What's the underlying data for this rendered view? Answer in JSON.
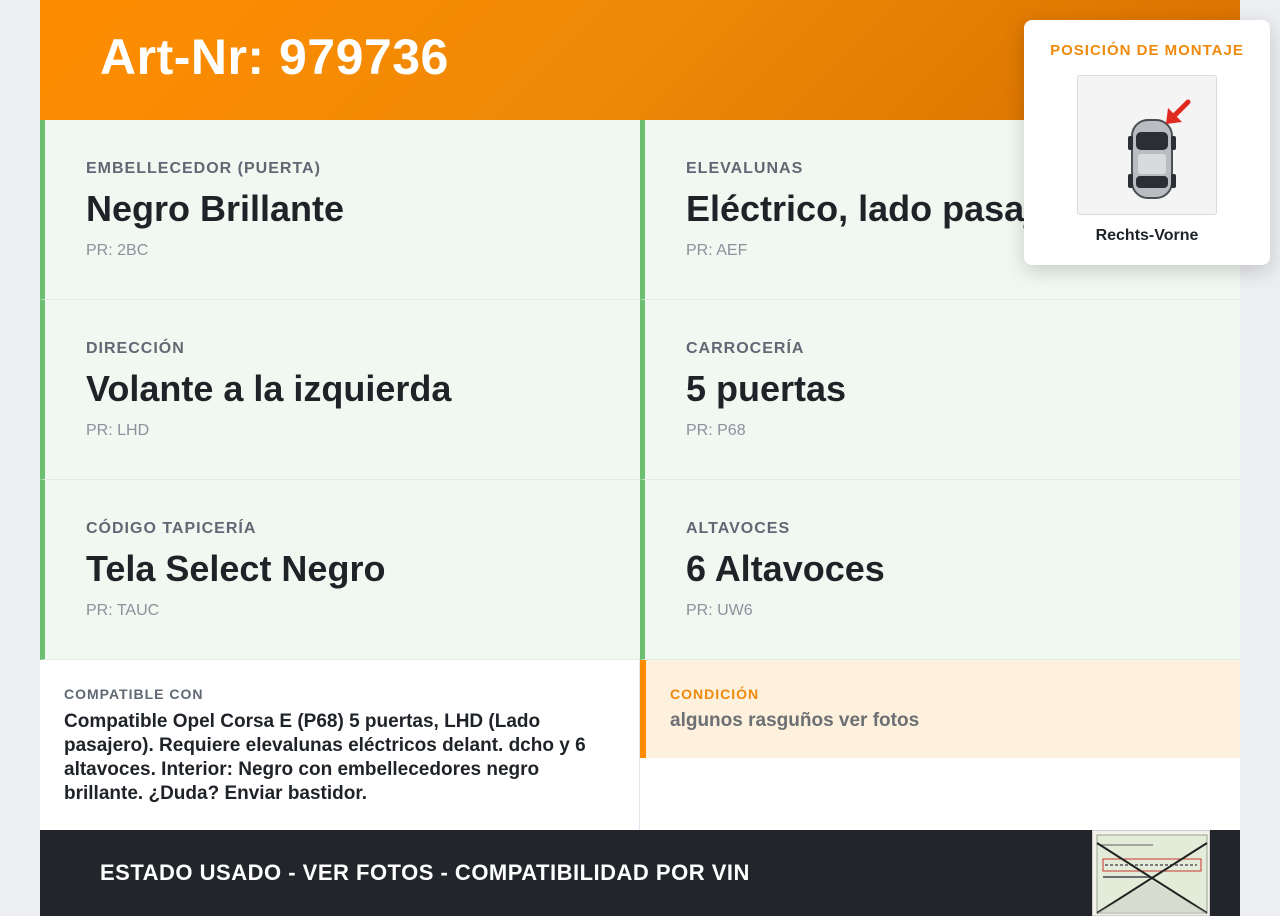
{
  "header": {
    "title": "Art-Nr: 979736"
  },
  "specs": [
    {
      "label": "EMBELLECEDOR (PUERTA)",
      "value": "Negro Brillante",
      "pr": "PR: 2BC"
    },
    {
      "label": "ELEVALUNAS",
      "value": "Eléctrico, lado pasajero",
      "pr": "PR: AEF"
    },
    {
      "label": "DIRECCIÓN",
      "value": "Volante a la izquierda",
      "pr": "PR: LHD"
    },
    {
      "label": "CARROCERÍA",
      "value": "5 puertas",
      "pr": "PR: P68"
    },
    {
      "label": "CÓDIGO TAPICERÍA",
      "value": "Tela Select Negro",
      "pr": "PR: TAUC"
    },
    {
      "label": "ALTAVOCES",
      "value": "6 Altavoces",
      "pr": "PR: UW6"
    }
  ],
  "compat": {
    "label": "COMPATIBLE CON",
    "text": "Compatible Opel Corsa E (P68) 5 puertas, LHD (Lado pasajero). Requiere elevalunas eléctricos delant. dcho y 6 altavoces. Interior: Negro con embellecedores negro brillante. ¿Duda? Enviar bastidor."
  },
  "condition": {
    "label": "CONDICIÓN",
    "text": "algunos rasguños ver fotos"
  },
  "footer": {
    "banner": "ESTADO USADO - VER FOTOS - COMPATIBILIDAD POR VIN"
  },
  "mount": {
    "title": "POSICIÓN DE MONTAJE",
    "position": "Rechts-Vorne"
  },
  "colors": {
    "accent": "#ff8c00",
    "spec_border": "#6bbf6e",
    "spec_bg": "#f1f8f1",
    "footer_bg": "#222529"
  }
}
